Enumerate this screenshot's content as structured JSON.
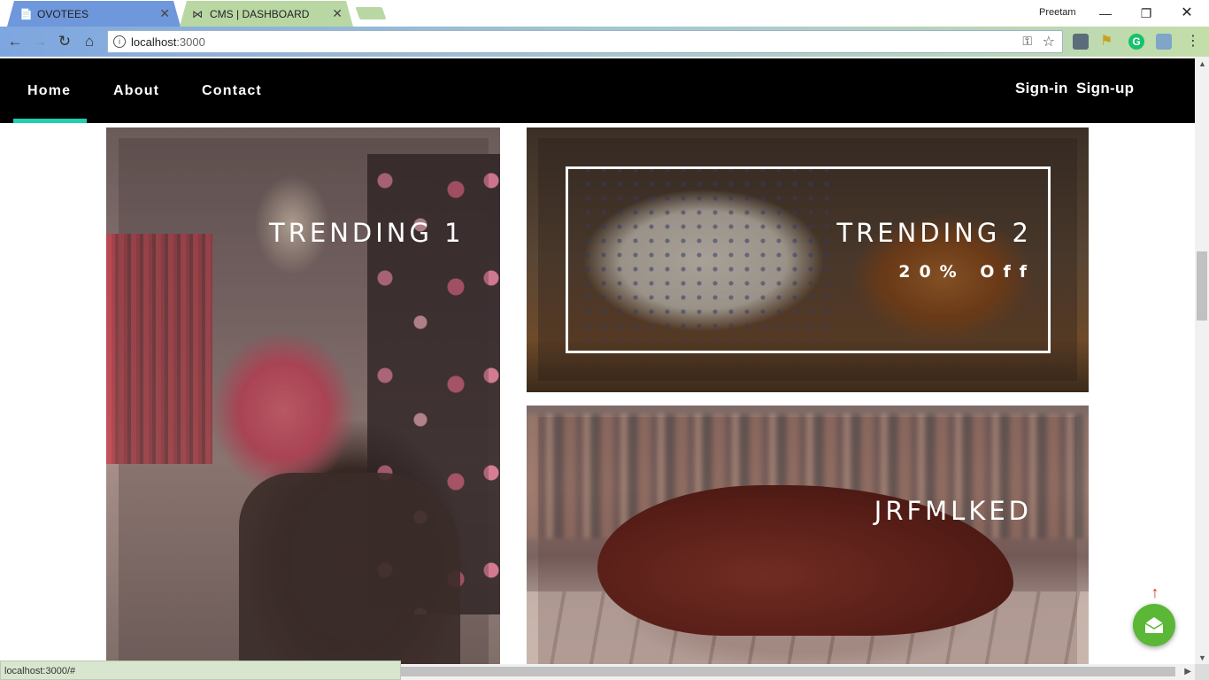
{
  "browser": {
    "tabs": [
      {
        "label": "OVOTEES",
        "icon": "page-icon"
      },
      {
        "label": "CMS | DASHBOARD",
        "icon": "bowtie-icon"
      }
    ],
    "profile": "Preetam",
    "address": {
      "host": "localhost",
      "port": ":3000"
    },
    "status_url": "localhost:3000/#"
  },
  "nav": {
    "links": [
      "Home",
      "About",
      "Contact"
    ],
    "active": "Home",
    "signin": "Sign-in",
    "signup": "Sign-up",
    "accent_color": "#1fcfb1"
  },
  "tiles": {
    "t1": {
      "title": "TRENDING 1"
    },
    "t2": {
      "title": "TRENDING 2",
      "subtitle": "20% Off"
    },
    "t3": {
      "title": "JRFMLKED"
    }
  },
  "fab": {
    "icon": "mail-icon",
    "color": "#5bb736"
  }
}
